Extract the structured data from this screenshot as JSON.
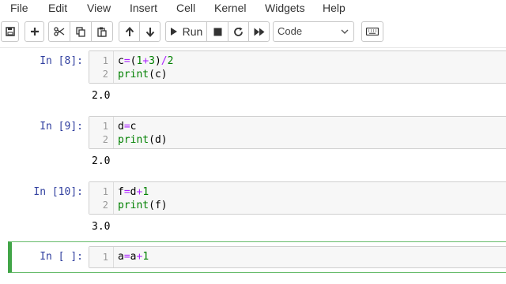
{
  "menu": [
    "File",
    "Edit",
    "View",
    "Insert",
    "Cell",
    "Kernel",
    "Widgets",
    "Help"
  ],
  "toolbar": {
    "save_icon": "save-icon",
    "add_icon": "plus-icon",
    "cut_icon": "scissors-icon",
    "copy_icon": "copy-icon",
    "paste_icon": "paste-icon",
    "move_up_icon": "arrow-up-icon",
    "move_down_icon": "arrow-down-icon",
    "run_label": "Run",
    "stop_icon": "stop-icon",
    "restart_icon": "restart-icon",
    "fast_forward_icon": "fast-forward-icon",
    "cell_type": "Code",
    "keyboard_icon": "keyboard-icon"
  },
  "cells": [
    {
      "prompt": "In [8]:",
      "lines": [
        {
          "num": "1",
          "code": "c=(1+3)/2"
        },
        {
          "num": "2",
          "code": "print(c)"
        }
      ],
      "output": "2.0"
    },
    {
      "prompt": "In [9]:",
      "lines": [
        {
          "num": "1",
          "code": "d=c"
        },
        {
          "num": "2",
          "code": "print(d)"
        }
      ],
      "output": "2.0"
    },
    {
      "prompt": "In [10]:",
      "lines": [
        {
          "num": "1",
          "code": "f=d+1"
        },
        {
          "num": "2",
          "code": "print(f)"
        }
      ],
      "output": "3.0"
    },
    {
      "prompt": "In [ ]:",
      "lines": [
        {
          "num": "1",
          "code": "a=a+1"
        }
      ],
      "output": ""
    }
  ],
  "colors": {
    "prompt": "#303f9f",
    "operator": "#aa22ff",
    "number": "#008000",
    "selected_border": "#42a548"
  }
}
